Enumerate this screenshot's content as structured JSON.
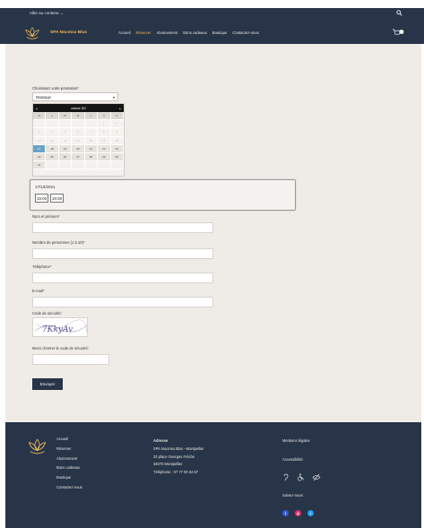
{
  "skip_link": "Aller au contenu →",
  "brand": "SPA Nocmsa Blus",
  "nav": [
    "Accueil",
    "Réserver",
    "Abonnement",
    "Bons cadeaux",
    "Boutique",
    "Contactez-nous"
  ],
  "active_nav": "Réserver",
  "form": {
    "service_label": "Choisissez votre prestation*",
    "service_value": "Massage",
    "calendar": {
      "month": "octobre 202",
      "days_of_week": [
        "D",
        "L",
        "M",
        "M",
        "J",
        "V",
        "S"
      ],
      "weeks": [
        [
          "",
          "",
          "",
          "",
          "",
          "1",
          "2"
        ],
        [
          "3",
          "4",
          "5",
          "6",
          "7",
          "8",
          "9"
        ],
        [
          "10",
          "11",
          "12",
          "13",
          "14",
          "15",
          "16"
        ],
        [
          "17",
          "18",
          "19",
          "20",
          "21",
          "22",
          "23"
        ],
        [
          "24",
          "25",
          "26",
          "27",
          "28",
          "29",
          "30"
        ],
        [
          "31",
          "",
          "",
          "",
          "",
          "",
          ""
        ]
      ]
    },
    "selected_date": "17/10/2021",
    "time_slots": [
      "19:00",
      "19:00"
    ],
    "name_label": "Nom et prénom*",
    "persons_label": "Nombre de personnes (1 à 10)*",
    "phone_label": "Téléphone*",
    "email_label": "E-mail*",
    "captcha_label": "Code de sécurité:",
    "captcha_text": "7KkyAv",
    "captcha_input_label": "Merci d'entrer le code de sécurité:",
    "submit_label": "Envoyer"
  },
  "footer": {
    "links": [
      "Accueil",
      "Réserver",
      "Abonnement",
      "Bons cadeaux",
      "Boutique",
      "Contactez-nous"
    ],
    "address_title": "Adresse",
    "address_lines": [
      "SPA Nocmsa Blus - Montpellier",
      "33 place Georges Fréche",
      "34070 Montpellier",
      "Téléphone : 07 77 00 34 67"
    ],
    "legal": "Mentions légales",
    "accessibility": "Accessibilité:",
    "follow": "Suivez-nous:",
    "accessibility_icons": [
      "ear-icon",
      "wheelchair-icon",
      "eye-slash-icon"
    ],
    "social_icons": [
      "facebook-icon",
      "instagram-icon",
      "twitter-icon"
    ]
  },
  "colors": {
    "navy": "#283447",
    "gold": "#e9b85a",
    "bg": "#efece8",
    "selected_day": "#6aa3c7"
  }
}
